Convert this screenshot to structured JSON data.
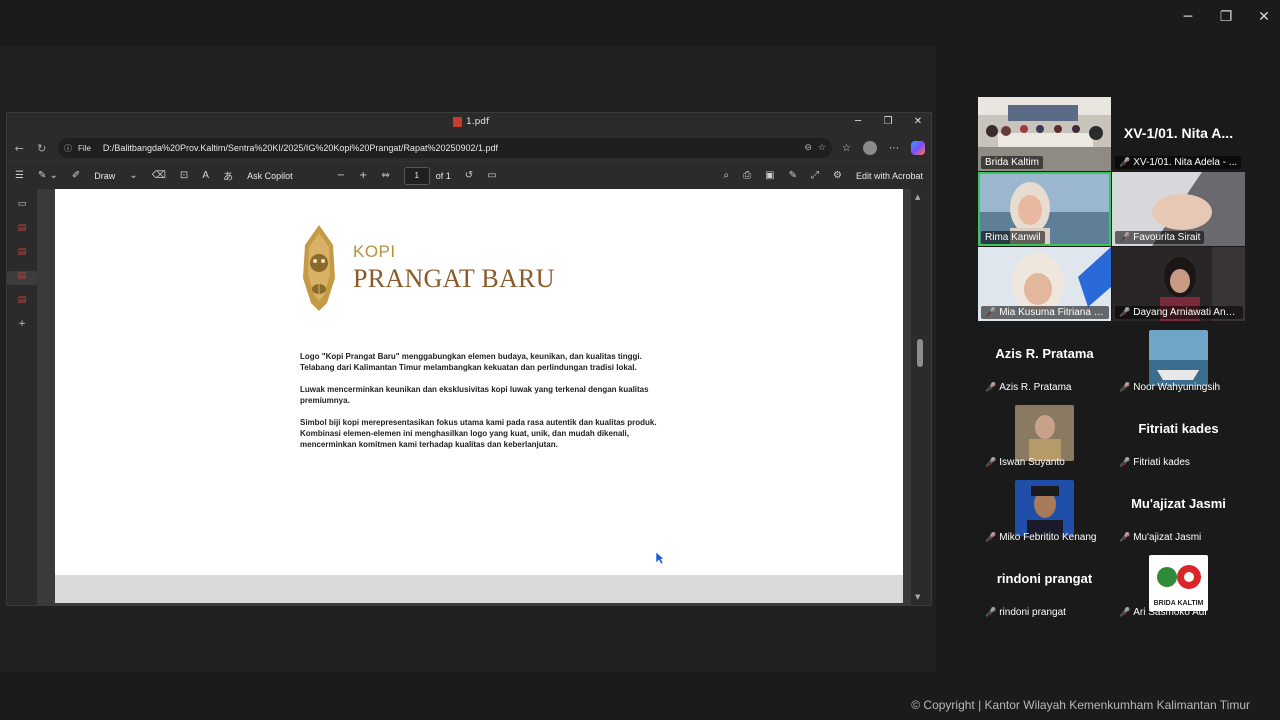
{
  "window_controls": {
    "minimize": "─",
    "maximize": "❐",
    "close": "✕"
  },
  "edge": {
    "tab_title": "1.pdf",
    "url_scheme": "File",
    "url": "D:/Balitbangda%20Prov.Kaltim/Sentra%20KI/2025/IG%20Kopi%20Prangat/Rapat%20250902/1.pdf",
    "toolbar": {
      "draw": "Draw",
      "ask_copilot": "Ask Copilot",
      "page_number": "1",
      "page_total": "of 1",
      "edit_acrobat": "Edit with Acrobat"
    }
  },
  "pdf": {
    "logo_kopi": "KOPI",
    "logo_name": "PRANGAT BARU",
    "paragraphs": [
      "Logo \"Kopi Prangat Baru\" menggabungkan elemen budaya, keunikan, dan kualitas tinggi. Telabang dari Kalimantan Timur melambangkan kekuatan dan perlindungan tradisi lokal.",
      "Luwak mencerminkan keunikan dan eksklusivitas kopi luwak yang terkenal dengan kualitas premiumnya.",
      "Simbol biji kopi merepresentasikan fokus utama kami pada rasa autentik dan kualitas produk. Kombinasi elemen-elemen ini menghasilkan logo yang kuat, unik, dan mudah dikenali, mencerminkan komitmen kami terhadap kualitas dan keberlanjutan."
    ]
  },
  "participants": [
    {
      "label": "Brida Kaltim",
      "muted": false,
      "kind": "video-room"
    },
    {
      "label": "XV-1/01. Nita Adela - ...",
      "big": "XV-1/01. Nita A...",
      "muted": true,
      "kind": "name"
    },
    {
      "label": "Rima Kanwil",
      "muted": false,
      "kind": "video-face",
      "active": true
    },
    {
      "label": "Favourita Sirait",
      "muted": true,
      "kind": "video-blur"
    },
    {
      "label": "Mia Kusuma Fitriana K...",
      "muted": true,
      "kind": "video-girl"
    },
    {
      "label": "Dayang Arniawati Anni...",
      "muted": true,
      "kind": "video-dark"
    },
    {
      "label": "Azis R. Pratama",
      "big": "Azis R. Pratama",
      "muted": true,
      "kind": "name"
    },
    {
      "label": "Noor Wahyuningsih",
      "muted": true,
      "kind": "thumb-boat"
    },
    {
      "label": "Iswan Suyanto",
      "muted": true,
      "kind": "thumb-man"
    },
    {
      "label": "Fitriati kades",
      "big": "Fitriati kades",
      "muted": true,
      "kind": "name"
    },
    {
      "label": "Miko Febritito Kenang",
      "muted": true,
      "kind": "thumb-man2"
    },
    {
      "label": "Mu'ajizat Jasmi",
      "big": "Mu'ajizat Jasmi",
      "muted": true,
      "kind": "name"
    },
    {
      "label": "rindoni prangat",
      "big": "rindoni prangat",
      "muted": true,
      "kind": "name"
    },
    {
      "label": "Ari Sasmoko Adi",
      "muted": true,
      "kind": "thumb-logo",
      "logo_text": "BRIDA KALTIM"
    }
  ],
  "copyright": "© Copyright | Kantor Wilayah Kemenkumham Kalimantan Timur",
  "colors": {
    "active_speaker": "#3cc55a",
    "mute": "#e03a3a",
    "logo_gold": "#b8903d",
    "logo_brown": "#8a5a2a"
  }
}
